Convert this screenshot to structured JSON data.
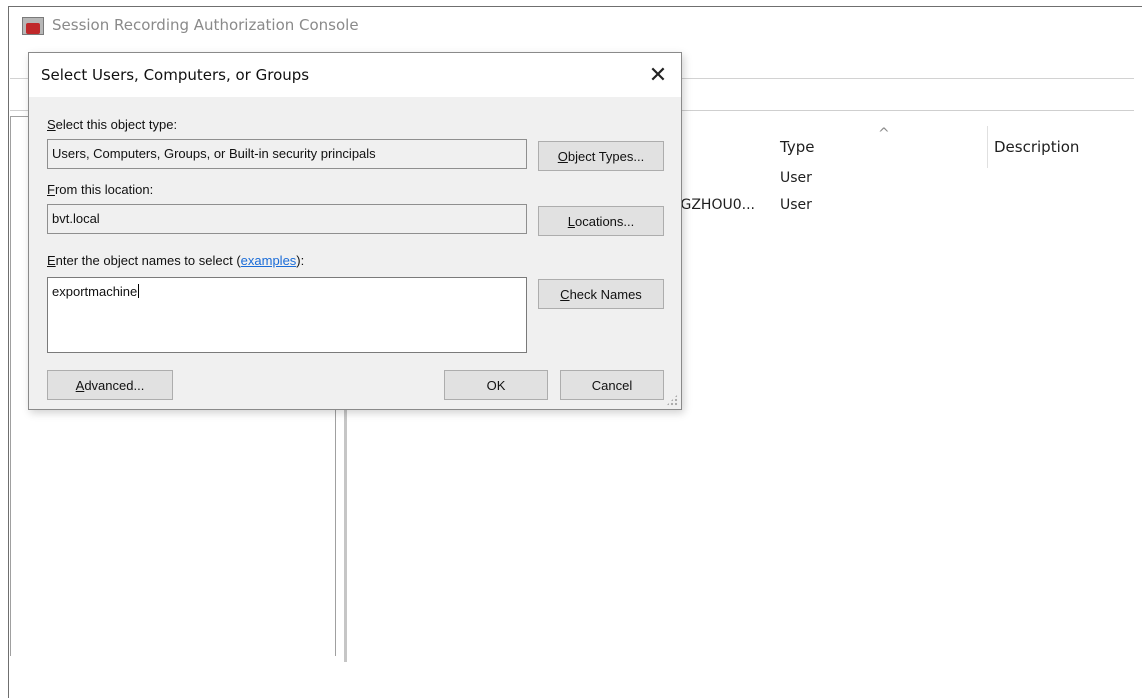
{
  "app": {
    "title": "Session Recording Authorization Console",
    "icon": "session-recording-app-icon"
  },
  "list": {
    "columns": {
      "name": "",
      "type": "Type",
      "description": "Description"
    },
    "sort_indicator": "^",
    "rows": [
      {
        "name": "",
        "type": "User"
      },
      {
        "name": "NGZHOU0...",
        "type": "User"
      }
    ]
  },
  "dialog": {
    "title": "Select Users, Computers, or Groups",
    "close_glyph": "✕",
    "object_type": {
      "label_first": "S",
      "label_rest": "elect this object type:",
      "value": "Users, Computers, Groups, or Built-in security principals",
      "button_first": "O",
      "button_rest": "bject Types..."
    },
    "location": {
      "label_first": "F",
      "label_rest": "rom this location:",
      "value": "bvt.local",
      "button_first": "L",
      "button_rest": "ocations..."
    },
    "names": {
      "label_first": "E",
      "label_rest": "nter the object names to select (",
      "link": "examples",
      "label_end": "):",
      "value": "exportmachine",
      "button_first": "C",
      "button_rest": "heck Names"
    },
    "advanced": {
      "first": "A",
      "rest": "dvanced..."
    },
    "ok": "OK",
    "cancel": "Cancel"
  }
}
